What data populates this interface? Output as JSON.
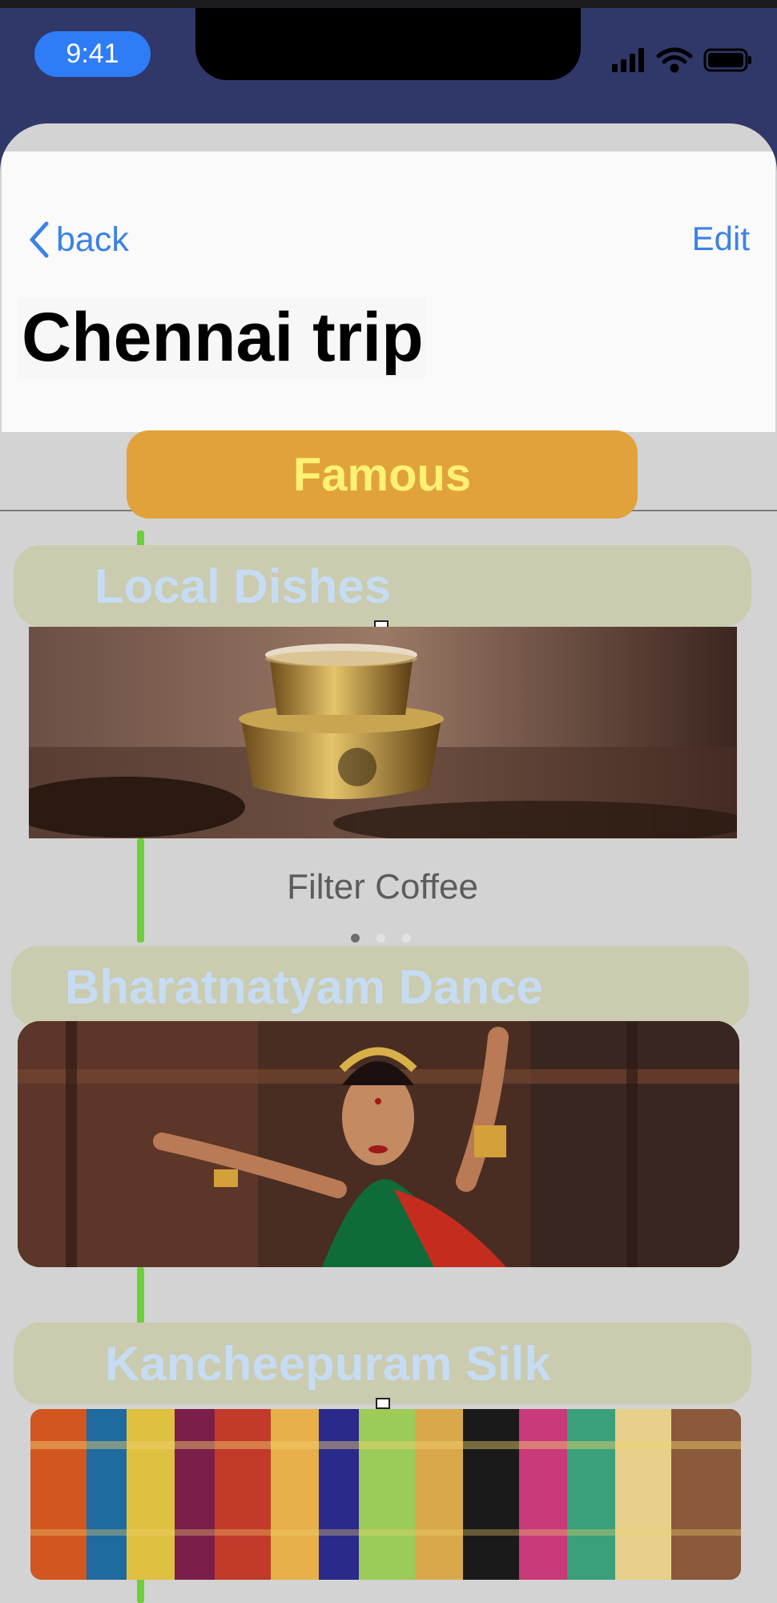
{
  "status_bar": {
    "time": "9:41"
  },
  "nav": {
    "back_label": "back",
    "edit_label": "Edit",
    "title": "Chennai trip"
  },
  "section_tab": {
    "label": "Famous"
  },
  "items": [
    {
      "label": "Local Dishes",
      "caption": "Filter Coffee"
    },
    {
      "label": "Bharatnatyam Dance"
    },
    {
      "label": "Kancheepuram Silk"
    }
  ],
  "pager": {
    "count": 3,
    "active_index": 0
  },
  "colors": {
    "accent": "#3b82e6",
    "famous_bg": "#e1a23b",
    "famous_text": "#fff173",
    "pill_bg": "#cacbaf",
    "pill_text": "#c6dcf2"
  }
}
